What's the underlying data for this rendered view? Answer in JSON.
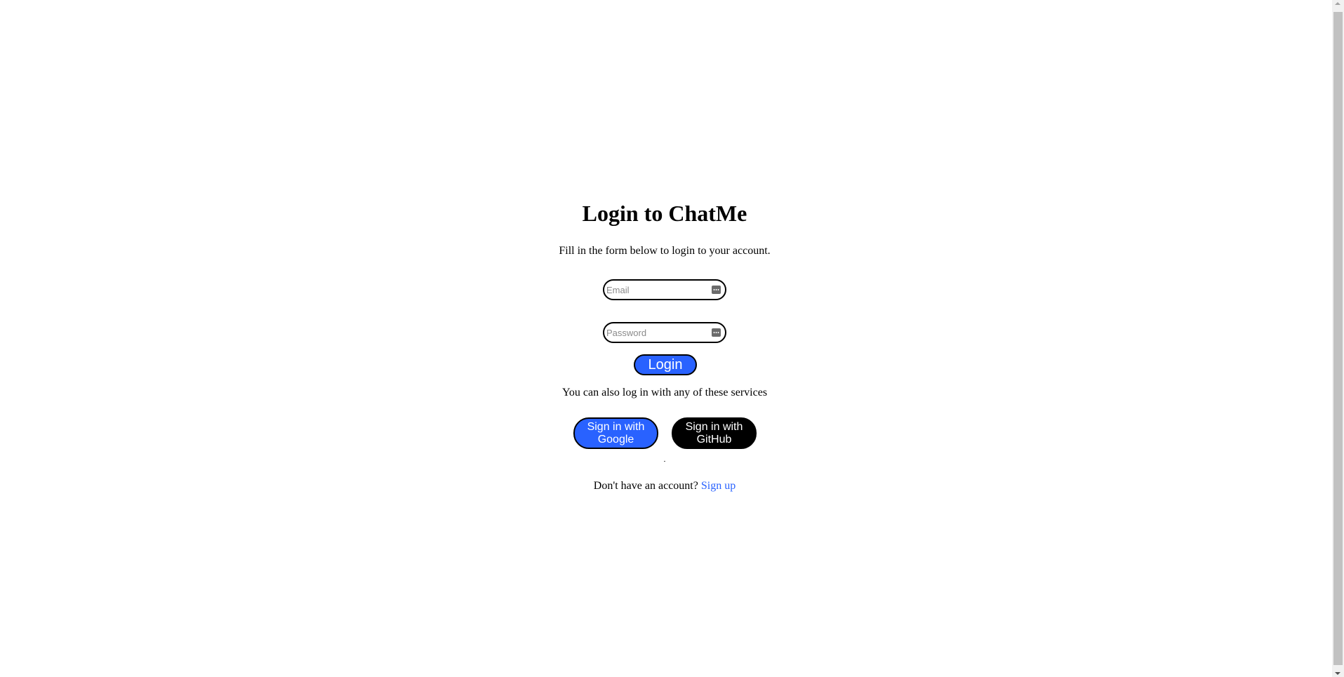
{
  "login": {
    "title": "Login to ChatMe",
    "subtitle": "Fill in the form below to login to your account.",
    "email": {
      "placeholder": "Email",
      "value": ""
    },
    "password": {
      "placeholder": "Password",
      "value": ""
    },
    "login_label": "Login",
    "alt_text": "You can also log in with any of these services",
    "google_label": "Sign in with Google",
    "github_label": "Sign in with GitHub",
    "signup_prompt": "Don't have an account?",
    "signup_link": "Sign up"
  },
  "colors": {
    "accent": "#2962ff",
    "github": "#000000",
    "background": "#ffffff"
  },
  "icons": {
    "field_icon": "password-manager-icon"
  }
}
